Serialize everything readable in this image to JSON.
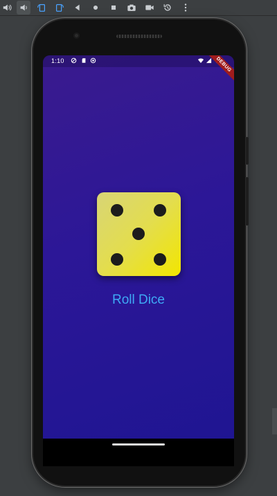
{
  "toolbar": {
    "buttons": [
      {
        "icon": "volume-up-icon"
      },
      {
        "icon": "volume-down-icon"
      },
      {
        "icon": "rotate-left-icon"
      },
      {
        "icon": "rotate-right-icon"
      },
      {
        "icon": "back-icon"
      },
      {
        "icon": "home-icon"
      },
      {
        "icon": "overview-icon"
      },
      {
        "icon": "camera-icon"
      },
      {
        "icon": "screenrecord-icon"
      },
      {
        "icon": "snapshot-icon"
      },
      {
        "icon": "more-icon"
      }
    ]
  },
  "status_bar": {
    "time": "1:10",
    "left_icons": [
      "shield-icon",
      "sd-card-icon",
      "sync-icon"
    ],
    "right_icons": [
      "wifi-icon",
      "signal-icon",
      "battery-icon"
    ]
  },
  "debug_banner": "DEBUG",
  "dice": {
    "face_value": 5,
    "colors": {
      "light": "#d8d576",
      "dark": "#f2e600",
      "pip": "#1c1c1c"
    }
  },
  "roll_button": {
    "label": "Roll Dice",
    "color": "#3ea9f5"
  },
  "theme": {
    "background_top": "#3a1b8e",
    "background_bottom": "#1f1592"
  }
}
